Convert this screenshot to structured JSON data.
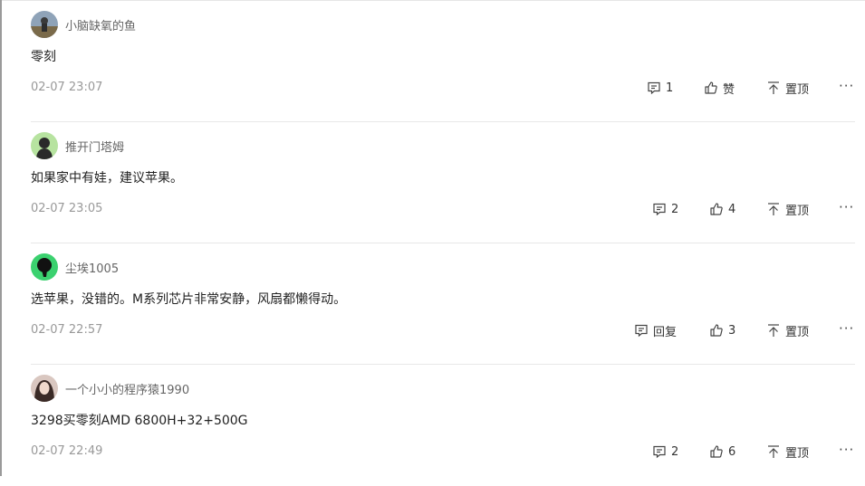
{
  "comments": [
    {
      "username": "小脑缺氧的鱼",
      "content": "零刻",
      "time": "02-07 23:07",
      "reply_label": "1",
      "like_label": "赞",
      "pin_label": "置顶",
      "more_label": "···"
    },
    {
      "username": "推开门塔姆",
      "content": "如果家中有娃，建议苹果。",
      "time": "02-07 23:05",
      "reply_label": "2",
      "like_label": "4",
      "pin_label": "置顶",
      "more_label": "···"
    },
    {
      "username": "尘埃1005",
      "content": "选苹果，没错的。M系列芯片非常安静，风扇都懒得动。",
      "time": "02-07 22:57",
      "reply_label": "回复",
      "like_label": "3",
      "pin_label": "置顶",
      "more_label": "···"
    },
    {
      "username": "一个小小的程序猿1990",
      "content": "3298买零刻AMD 6800H+32+500G",
      "time": "02-07 22:49",
      "reply_label": "2",
      "like_label": "6",
      "pin_label": "置顶",
      "more_label": "···"
    }
  ],
  "colors": {
    "text": "#222222",
    "meta": "#999999",
    "username": "#666666",
    "divider": "#e8e8e8"
  },
  "icons": {
    "reply": "comment-bubble-icon",
    "like": "thumbs-up-icon",
    "pin": "pin-to-top-icon",
    "more": "more-dots-icon"
  }
}
